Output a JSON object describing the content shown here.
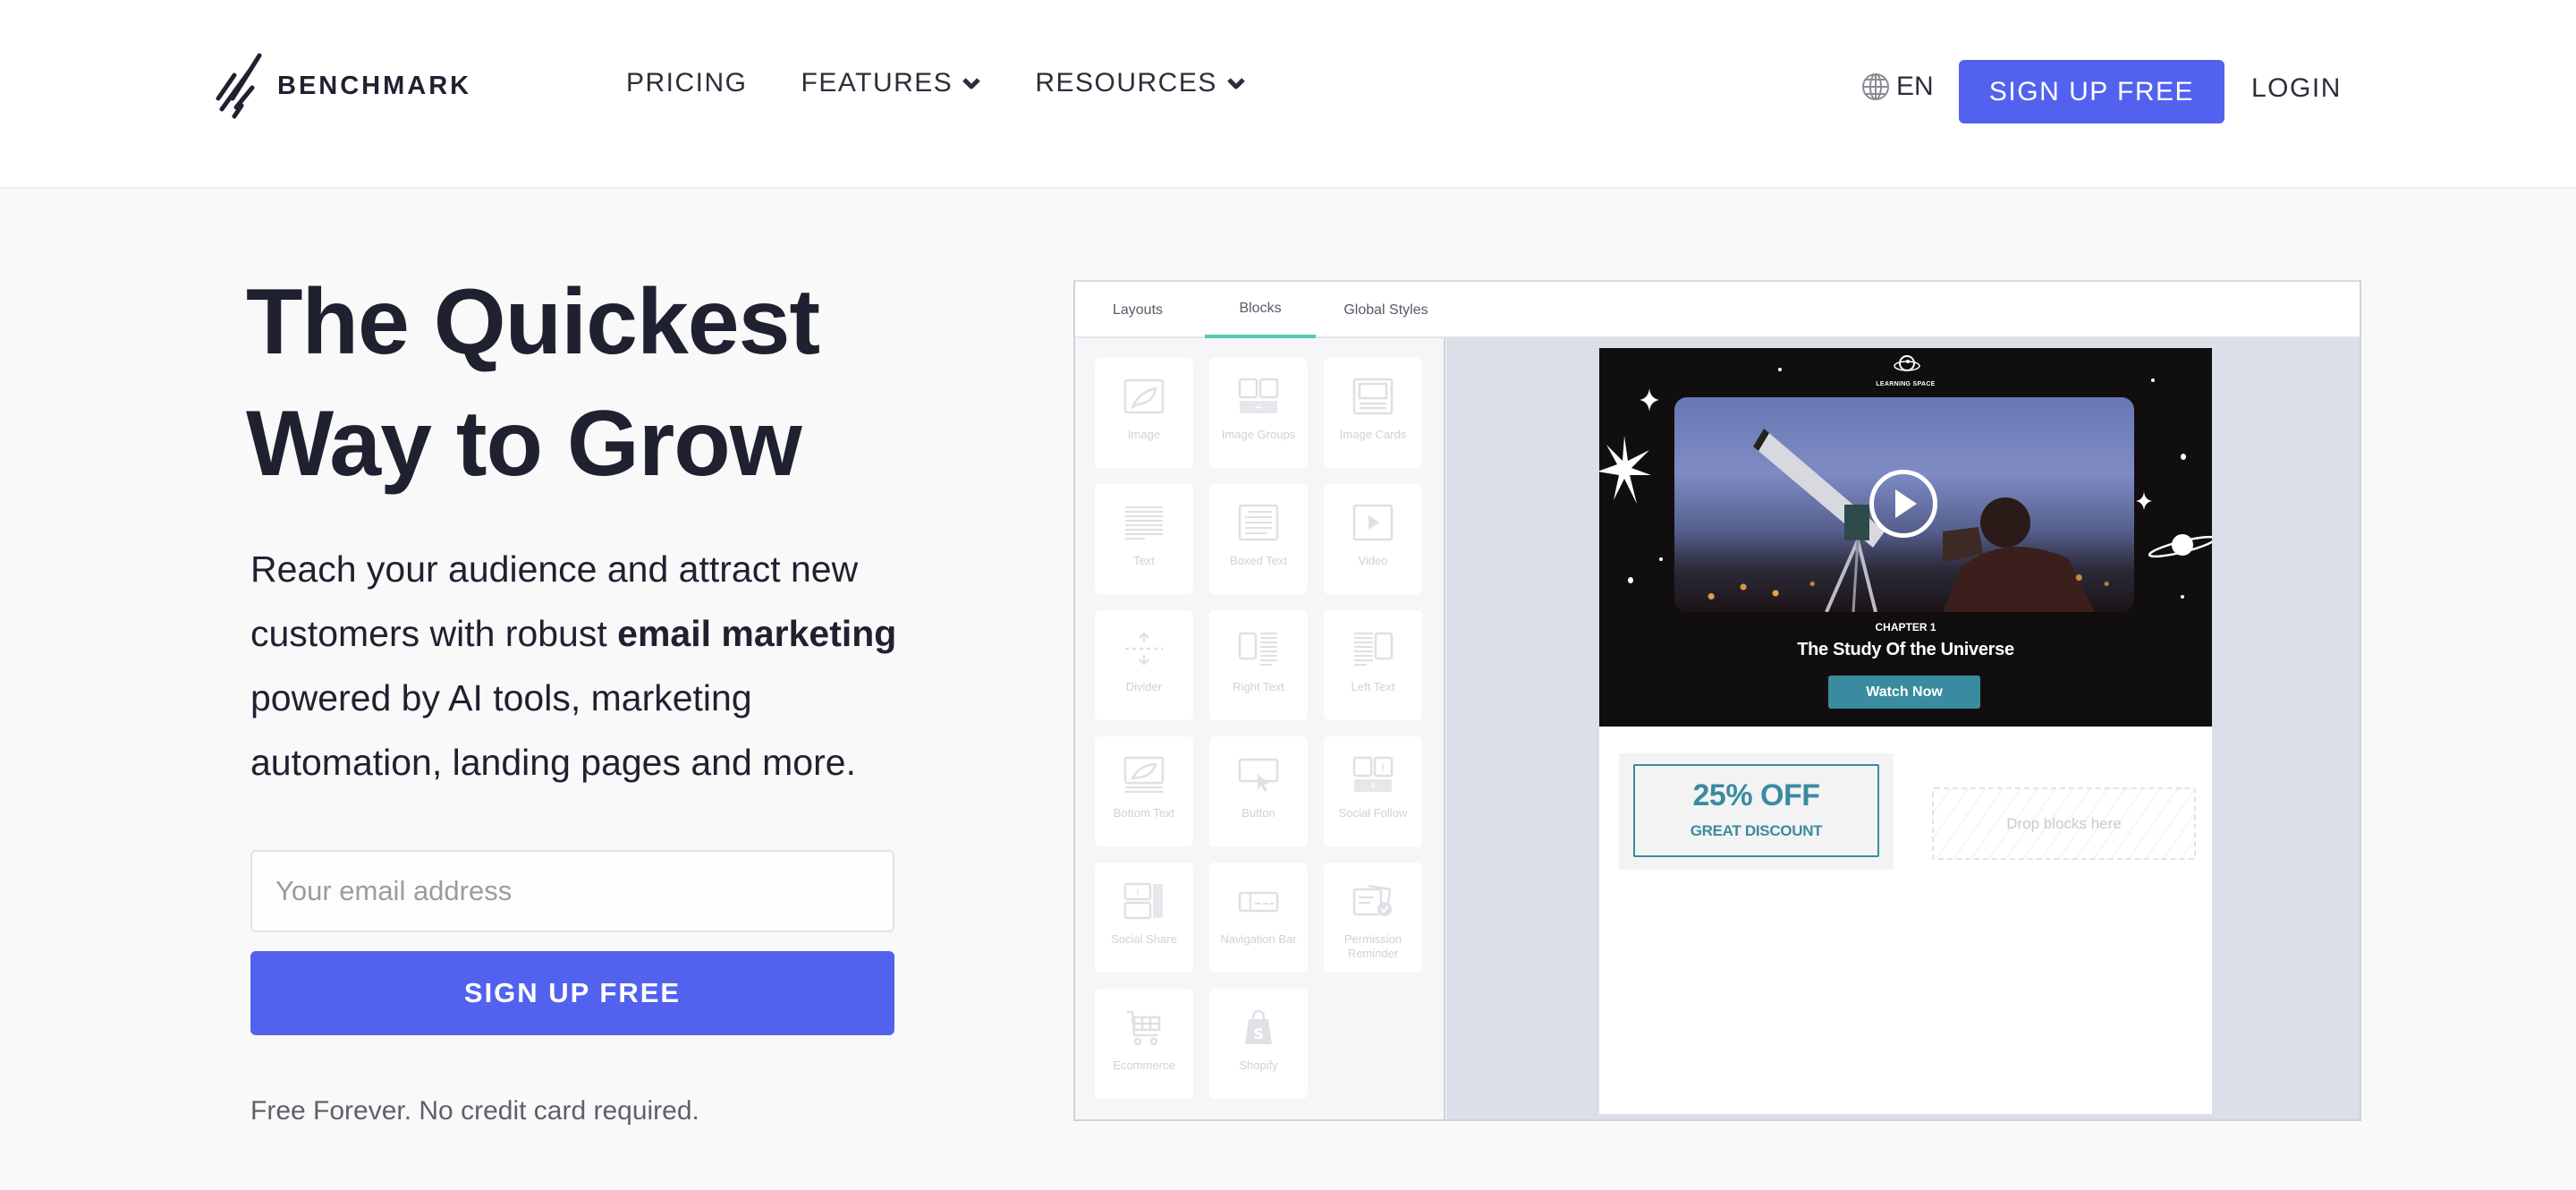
{
  "header": {
    "brand": "BENCHMARK",
    "nav": [
      {
        "label": "PRICING",
        "has_dropdown": false
      },
      {
        "label": "FEATURES",
        "has_dropdown": true
      },
      {
        "label": "RESOURCES",
        "has_dropdown": true
      }
    ],
    "language": "EN",
    "signup_label": "SIGN UP FREE",
    "login_label": "LOGIN"
  },
  "hero": {
    "title_line1": "The Quickest",
    "title_line2": "Way to Grow",
    "subtitle_pre": "Reach your audience and attract new customers with robust ",
    "subtitle_bold": "email marketing",
    "subtitle_post": " powered by AI tools, marketing automation, landing pages and more.",
    "email_placeholder": "Your email address",
    "email_value": "",
    "signup_label": "SIGN UP FREE",
    "footnote": "Free Forever. No credit card required."
  },
  "builder": {
    "tabs": [
      {
        "label": "Layouts",
        "active": false
      },
      {
        "label": "Blocks",
        "active": true
      },
      {
        "label": "Global Styles",
        "active": false
      }
    ],
    "blocks": [
      {
        "label": "Image",
        "icon": "image-icon"
      },
      {
        "label": "Image Groups",
        "icon": "image-groups-icon"
      },
      {
        "label": "Image Cards",
        "icon": "image-cards-icon"
      },
      {
        "label": "Text",
        "icon": "text-icon"
      },
      {
        "label": "Boxed Text",
        "icon": "boxed-text-icon"
      },
      {
        "label": "Video",
        "icon": "video-icon"
      },
      {
        "label": "Divider",
        "icon": "divider-icon"
      },
      {
        "label": "Right Text",
        "icon": "right-text-icon"
      },
      {
        "label": "Left Text",
        "icon": "left-text-icon"
      },
      {
        "label": "Bottom Text",
        "icon": "bottom-text-icon"
      },
      {
        "label": "Button",
        "icon": "button-icon"
      },
      {
        "label": "Social Follow",
        "icon": "social-follow-icon"
      },
      {
        "label": "Social Share",
        "icon": "social-share-icon"
      },
      {
        "label": "Navigation Bar",
        "icon": "navigation-bar-icon"
      },
      {
        "label": "Permission Reminder",
        "icon": "permission-reminder-icon"
      },
      {
        "label": "Ecommerce",
        "icon": "cart-icon"
      },
      {
        "label": "Shopify",
        "icon": "shopify-icon"
      }
    ],
    "email": {
      "logo_text": "LEARNING SPACE",
      "chapter": "CHAPTER 1",
      "title": "The Study Of the Universe",
      "cta": "Watch Now",
      "promo_big": "25% OFF",
      "promo_small": "GREAT DISCOUNT",
      "dropzone": "Drop blocks here"
    }
  },
  "colors": {
    "brand_blue": "#5262ef",
    "tab_active": "#55c7b4",
    "email_accent": "#3a8ba0",
    "text_dark": "#1f2130"
  }
}
